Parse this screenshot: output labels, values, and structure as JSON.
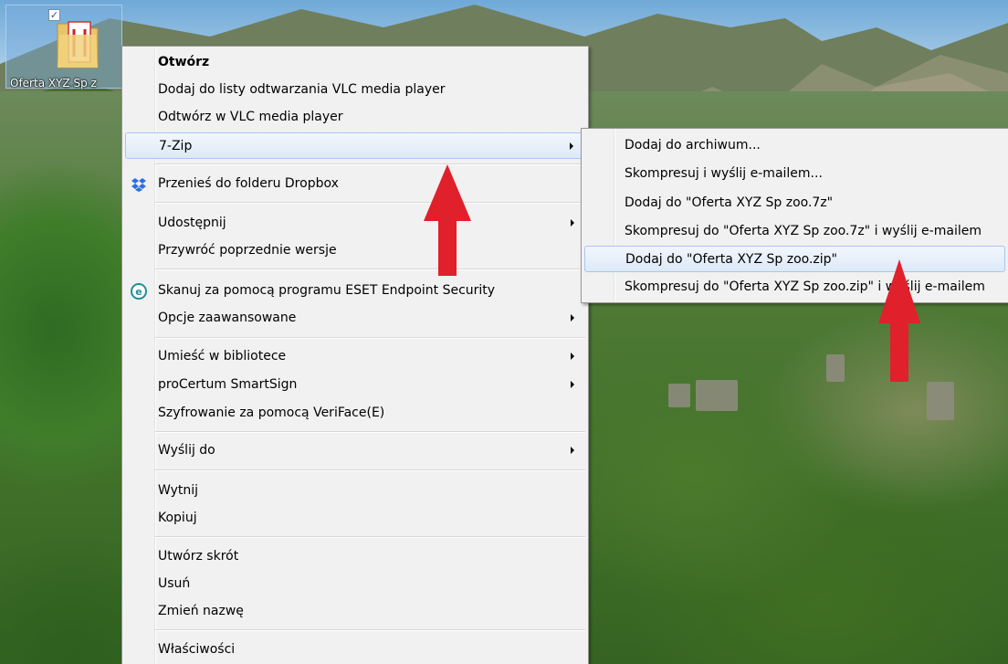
{
  "desktop": {
    "icon_label": "Oferta XYZ Sp z"
  },
  "context_menu": {
    "items": [
      {
        "label": "Otwórz"
      },
      {
        "label": "Dodaj do listy odtwarzania VLC media player"
      },
      {
        "label": "Odtwórz w VLC media player"
      },
      {
        "label": "7-Zip"
      },
      {
        "label": "Przenieś do folderu Dropbox",
        "icon": "dropbox-icon"
      },
      {
        "label": "Udostępnij"
      },
      {
        "label": "Przywróć poprzednie wersje"
      },
      {
        "label": "Skanuj za pomocą programu ESET Endpoint Security",
        "icon": "eset-icon"
      },
      {
        "label": "Opcje zaawansowane"
      },
      {
        "label": "Umieść w bibliotece"
      },
      {
        "label": "proCertum SmartSign"
      },
      {
        "label": "Szyfrowanie za pomocą VeriFace(E)"
      },
      {
        "label": "Wyślij do"
      },
      {
        "label": "Wytnij"
      },
      {
        "label": "Kopiuj"
      },
      {
        "label": "Utwórz skrót"
      },
      {
        "label": "Usuń"
      },
      {
        "label": "Zmień nazwę"
      },
      {
        "label": "Właściwości"
      }
    ]
  },
  "submenu_7zip": {
    "items": [
      {
        "label": "Dodaj do archiwum..."
      },
      {
        "label": "Skompresuj i wyślij e-mailem..."
      },
      {
        "label": "Dodaj do \"Oferta XYZ Sp zoo.7z\""
      },
      {
        "label": "Skompresuj do \"Oferta XYZ Sp zoo.7z\" i wyślij e-mailem"
      },
      {
        "label": "Dodaj do \"Oferta XYZ Sp zoo.zip\""
      },
      {
        "label": "Skompresuj do \"Oferta XYZ Sp zoo.zip\" i wyślij e-mailem"
      }
    ]
  },
  "colors": {
    "annotation_arrow": "#e0202a",
    "highlight_border": "#a9c6ee",
    "menu_background": "#f1f1f1",
    "dropbox": "#2c6fe0",
    "eset": "#1f8f9a"
  }
}
